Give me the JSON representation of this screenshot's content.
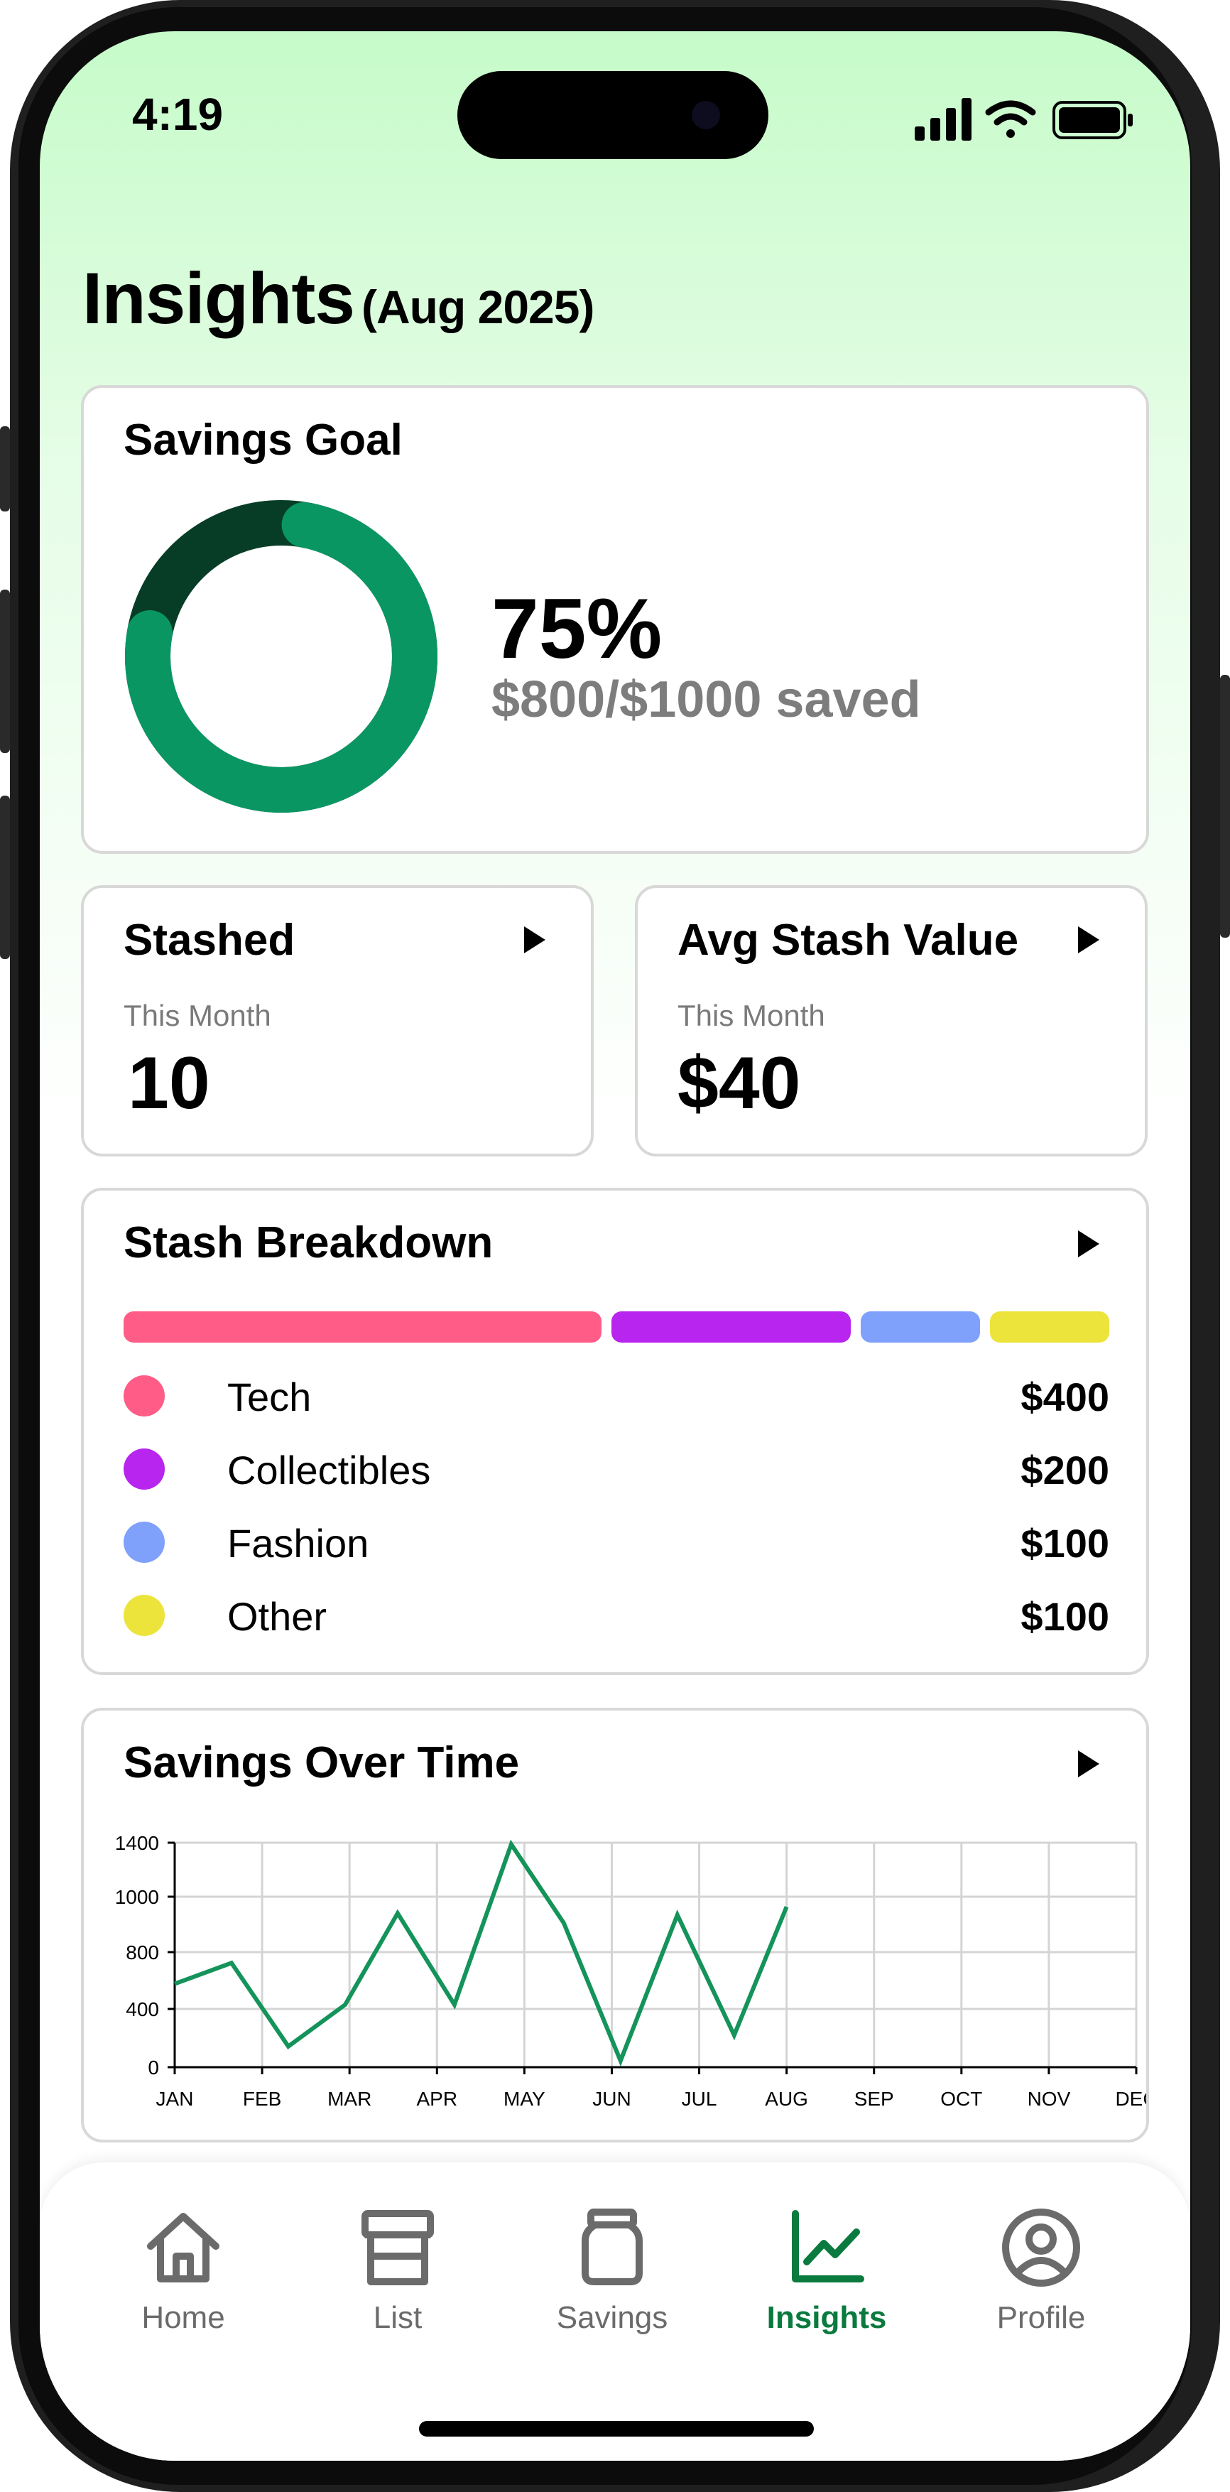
{
  "status_bar": {
    "time": "4:19"
  },
  "header": {
    "title": "Insights",
    "period": "(Aug 2025)"
  },
  "savings_goal": {
    "title": "Savings Goal",
    "percent_label": "75%",
    "percent": 0.75,
    "saved_label": "$800/$1000 saved",
    "colors": {
      "progress": "#0a9663",
      "remaining": "#073d27"
    }
  },
  "stashed": {
    "title": "Stashed",
    "period": "This Month",
    "value": "10"
  },
  "avg_stash": {
    "title": "Avg Stash Value",
    "period": "This Month",
    "value": "$40"
  },
  "breakdown": {
    "title": "Stash Breakdown",
    "items": [
      {
        "label": "Tech",
        "value": "$400",
        "amount": 400,
        "color": "#ff5c87"
      },
      {
        "label": "Collectibles",
        "value": "$200",
        "amount": 200,
        "color": "#b825ee"
      },
      {
        "label": "Fashion",
        "value": "$100",
        "amount": 100,
        "color": "#7fa1fb"
      },
      {
        "label": "Other",
        "value": "$100",
        "amount": 100,
        "color": "#ece43b"
      }
    ]
  },
  "savings_over_time": {
    "title": "Savings Over Time"
  },
  "chart_data": {
    "type": "line",
    "title": "Savings Over Time",
    "categories": [
      "JAN",
      "FEB",
      "MAR",
      "APR",
      "MAY",
      "JUN",
      "JUL",
      "AUG",
      "SEP",
      "OCT",
      "NOV",
      "DEC"
    ],
    "y_ticks": [
      "0",
      "400",
      "800",
      "1000",
      "1400"
    ],
    "ylim": [
      0,
      1400
    ],
    "grid": true,
    "line_color": "#14935a",
    "points": [
      {
        "x": 0.0,
        "y": 520
      },
      {
        "x": 0.65,
        "y": 650
      },
      {
        "x": 1.3,
        "y": 130
      },
      {
        "x": 1.95,
        "y": 390
      },
      {
        "x": 2.55,
        "y": 960
      },
      {
        "x": 3.2,
        "y": 390
      },
      {
        "x": 3.85,
        "y": 1390
      },
      {
        "x": 4.45,
        "y": 900
      },
      {
        "x": 5.1,
        "y": 40
      },
      {
        "x": 5.75,
        "y": 950
      },
      {
        "x": 6.4,
        "y": 200
      },
      {
        "x": 7.0,
        "y": 1000
      }
    ]
  },
  "tabbar": {
    "items": [
      {
        "label": "Home",
        "icon": "home-icon"
      },
      {
        "label": "List",
        "icon": "store-icon"
      },
      {
        "label": "Savings",
        "icon": "jar-icon"
      },
      {
        "label": "Insights",
        "icon": "chart-icon",
        "active": true
      },
      {
        "label": "Profile",
        "icon": "user-circle-icon"
      }
    ],
    "colors": {
      "active": "#0a7a3e",
      "inactive": "#6b6b6b"
    }
  }
}
